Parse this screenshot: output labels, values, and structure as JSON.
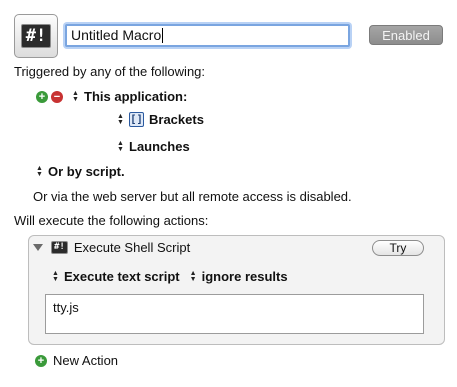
{
  "macro": {
    "name": "Untitled Macro",
    "icon": "terminal-icon",
    "icon_text": "#!",
    "enabled_label": "Enabled"
  },
  "triggers": {
    "heading": "Triggered by any of the following:",
    "application_trigger": {
      "label": "This application:",
      "app_name": "Brackets",
      "app_icon_text": "[ ]",
      "event": "Launches"
    },
    "script_trigger": "Or by script.",
    "web_server_note": "Or via the web server but all remote access is disabled."
  },
  "actions": {
    "heading": "Will execute the following actions:",
    "items": [
      {
        "title": "Execute Shell Script",
        "try_label": "Try",
        "mode": "Execute text script",
        "results": "ignore results",
        "script": "tty.js"
      }
    ],
    "new_action_label": "New Action"
  },
  "colors": {
    "focus_ring": "#7aa5e0",
    "add_green": "#3a9a3a",
    "remove_red": "#c83232",
    "enabled_button": "#989898"
  }
}
